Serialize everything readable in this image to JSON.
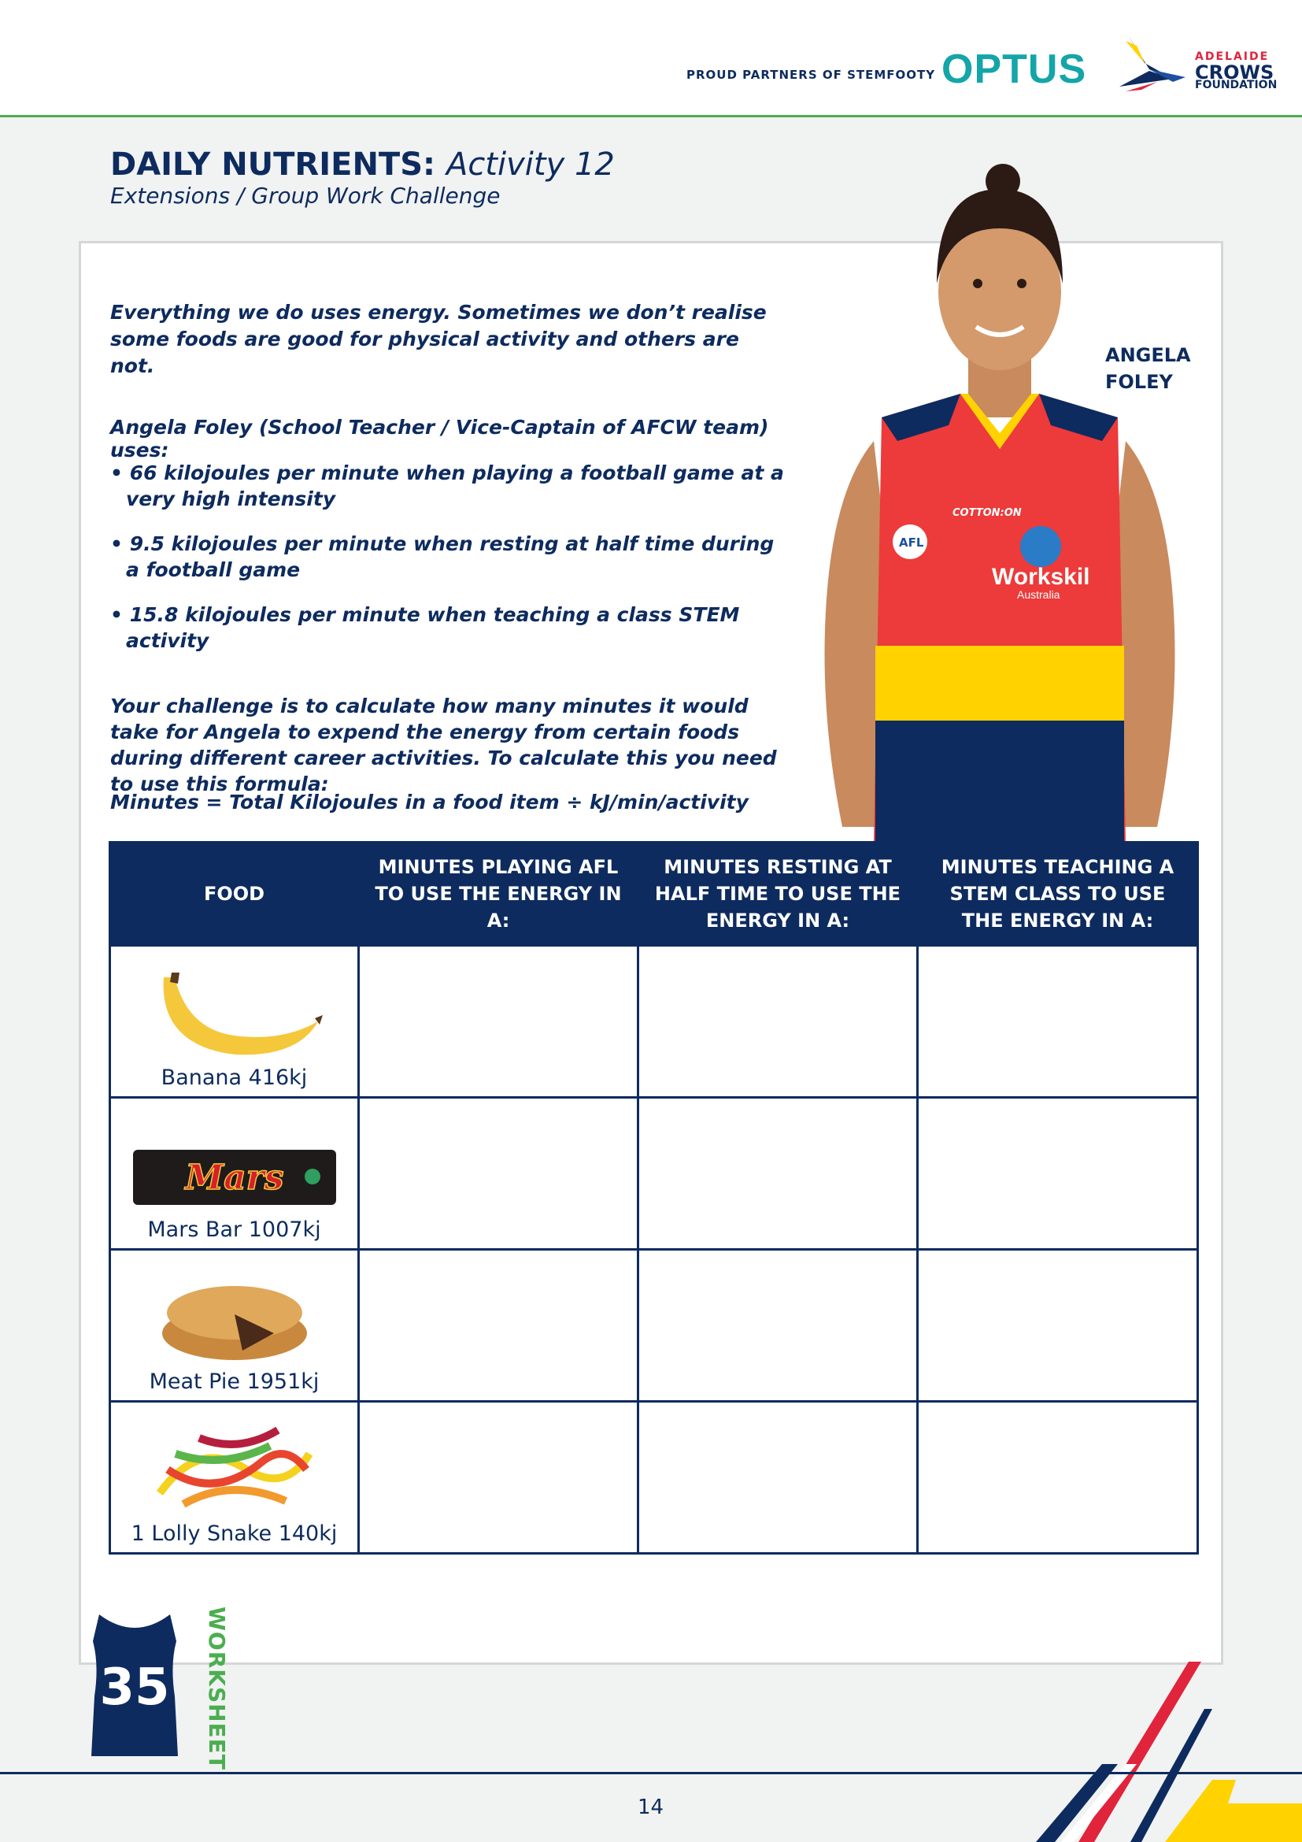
{
  "header": {
    "partners_text": "PROUD PARTNERS OF STEMFOOTY",
    "optus_logo": "OPTUS",
    "crows_small": "ADELAIDE",
    "crows_big": "CROWS",
    "crows_foundation": "FOUNDATION"
  },
  "title": {
    "prefix": "DAILY NUTRIENTS:",
    "activity": "Activity 12",
    "subtitle": "Extensions / Group Work Challenge"
  },
  "intro": "Everything we do uses energy. Sometimes we don’t realise some foods are good for physical activity and others are not.",
  "uses_heading": "Angela Foley (School Teacher / Vice-Captain of AFCW team) uses:",
  "bullets": [
    "66 kilojoules per minute when playing a football game at a very high intensity",
    "9.5 kilojoules per minute when resting at half time during a football game",
    "15.8 kilojoules per minute when teaching a class STEM activity"
  ],
  "challenge": "Your challenge is to calculate how many minutes it would take for Angela to expend the energy from certain foods during different career activities. To calculate this you need to use this formula:",
  "formula": "Minutes = Total Kilojoules in a food item ÷ kJ/min/activity",
  "player": {
    "first": "ANGELA",
    "last": "FOLEY",
    "guernsey_sponsor_top": "COTTON:ON",
    "guernsey_badge": "AFL",
    "guernsey_sponsor": "Workskil",
    "guernsey_sponsor_sub": "Australia"
  },
  "table": {
    "headers": [
      "FOOD",
      "MINUTES PLAYING AFL TO USE THE ENERGY IN A:",
      "MINUTES RESTING AT HALF TIME TO USE THE ENERGY IN A:",
      "MINUTES TEACHING A STEM CLASS TO USE THE ENERGY IN A:"
    ],
    "rows": [
      {
        "food": "Banana 416kj",
        "icon": "banana-icon"
      },
      {
        "food": "Mars Bar 1007kj",
        "icon": "mars-bar-icon",
        "wrapper_text": "Mars"
      },
      {
        "food": "Meat Pie 1951kj",
        "icon": "meat-pie-icon"
      },
      {
        "food": "1 Lolly Snake 140kj",
        "icon": "lolly-snakes-icon"
      }
    ]
  },
  "worksheet": {
    "number": "35",
    "label": "WORKSHEET"
  },
  "footer": {
    "page_number": "14"
  },
  "colors": {
    "navy": "#0d2b5e",
    "green": "#4bae4f",
    "teal": "#14a5a8",
    "red": "#e0243b",
    "yellow": "#ffd200"
  }
}
